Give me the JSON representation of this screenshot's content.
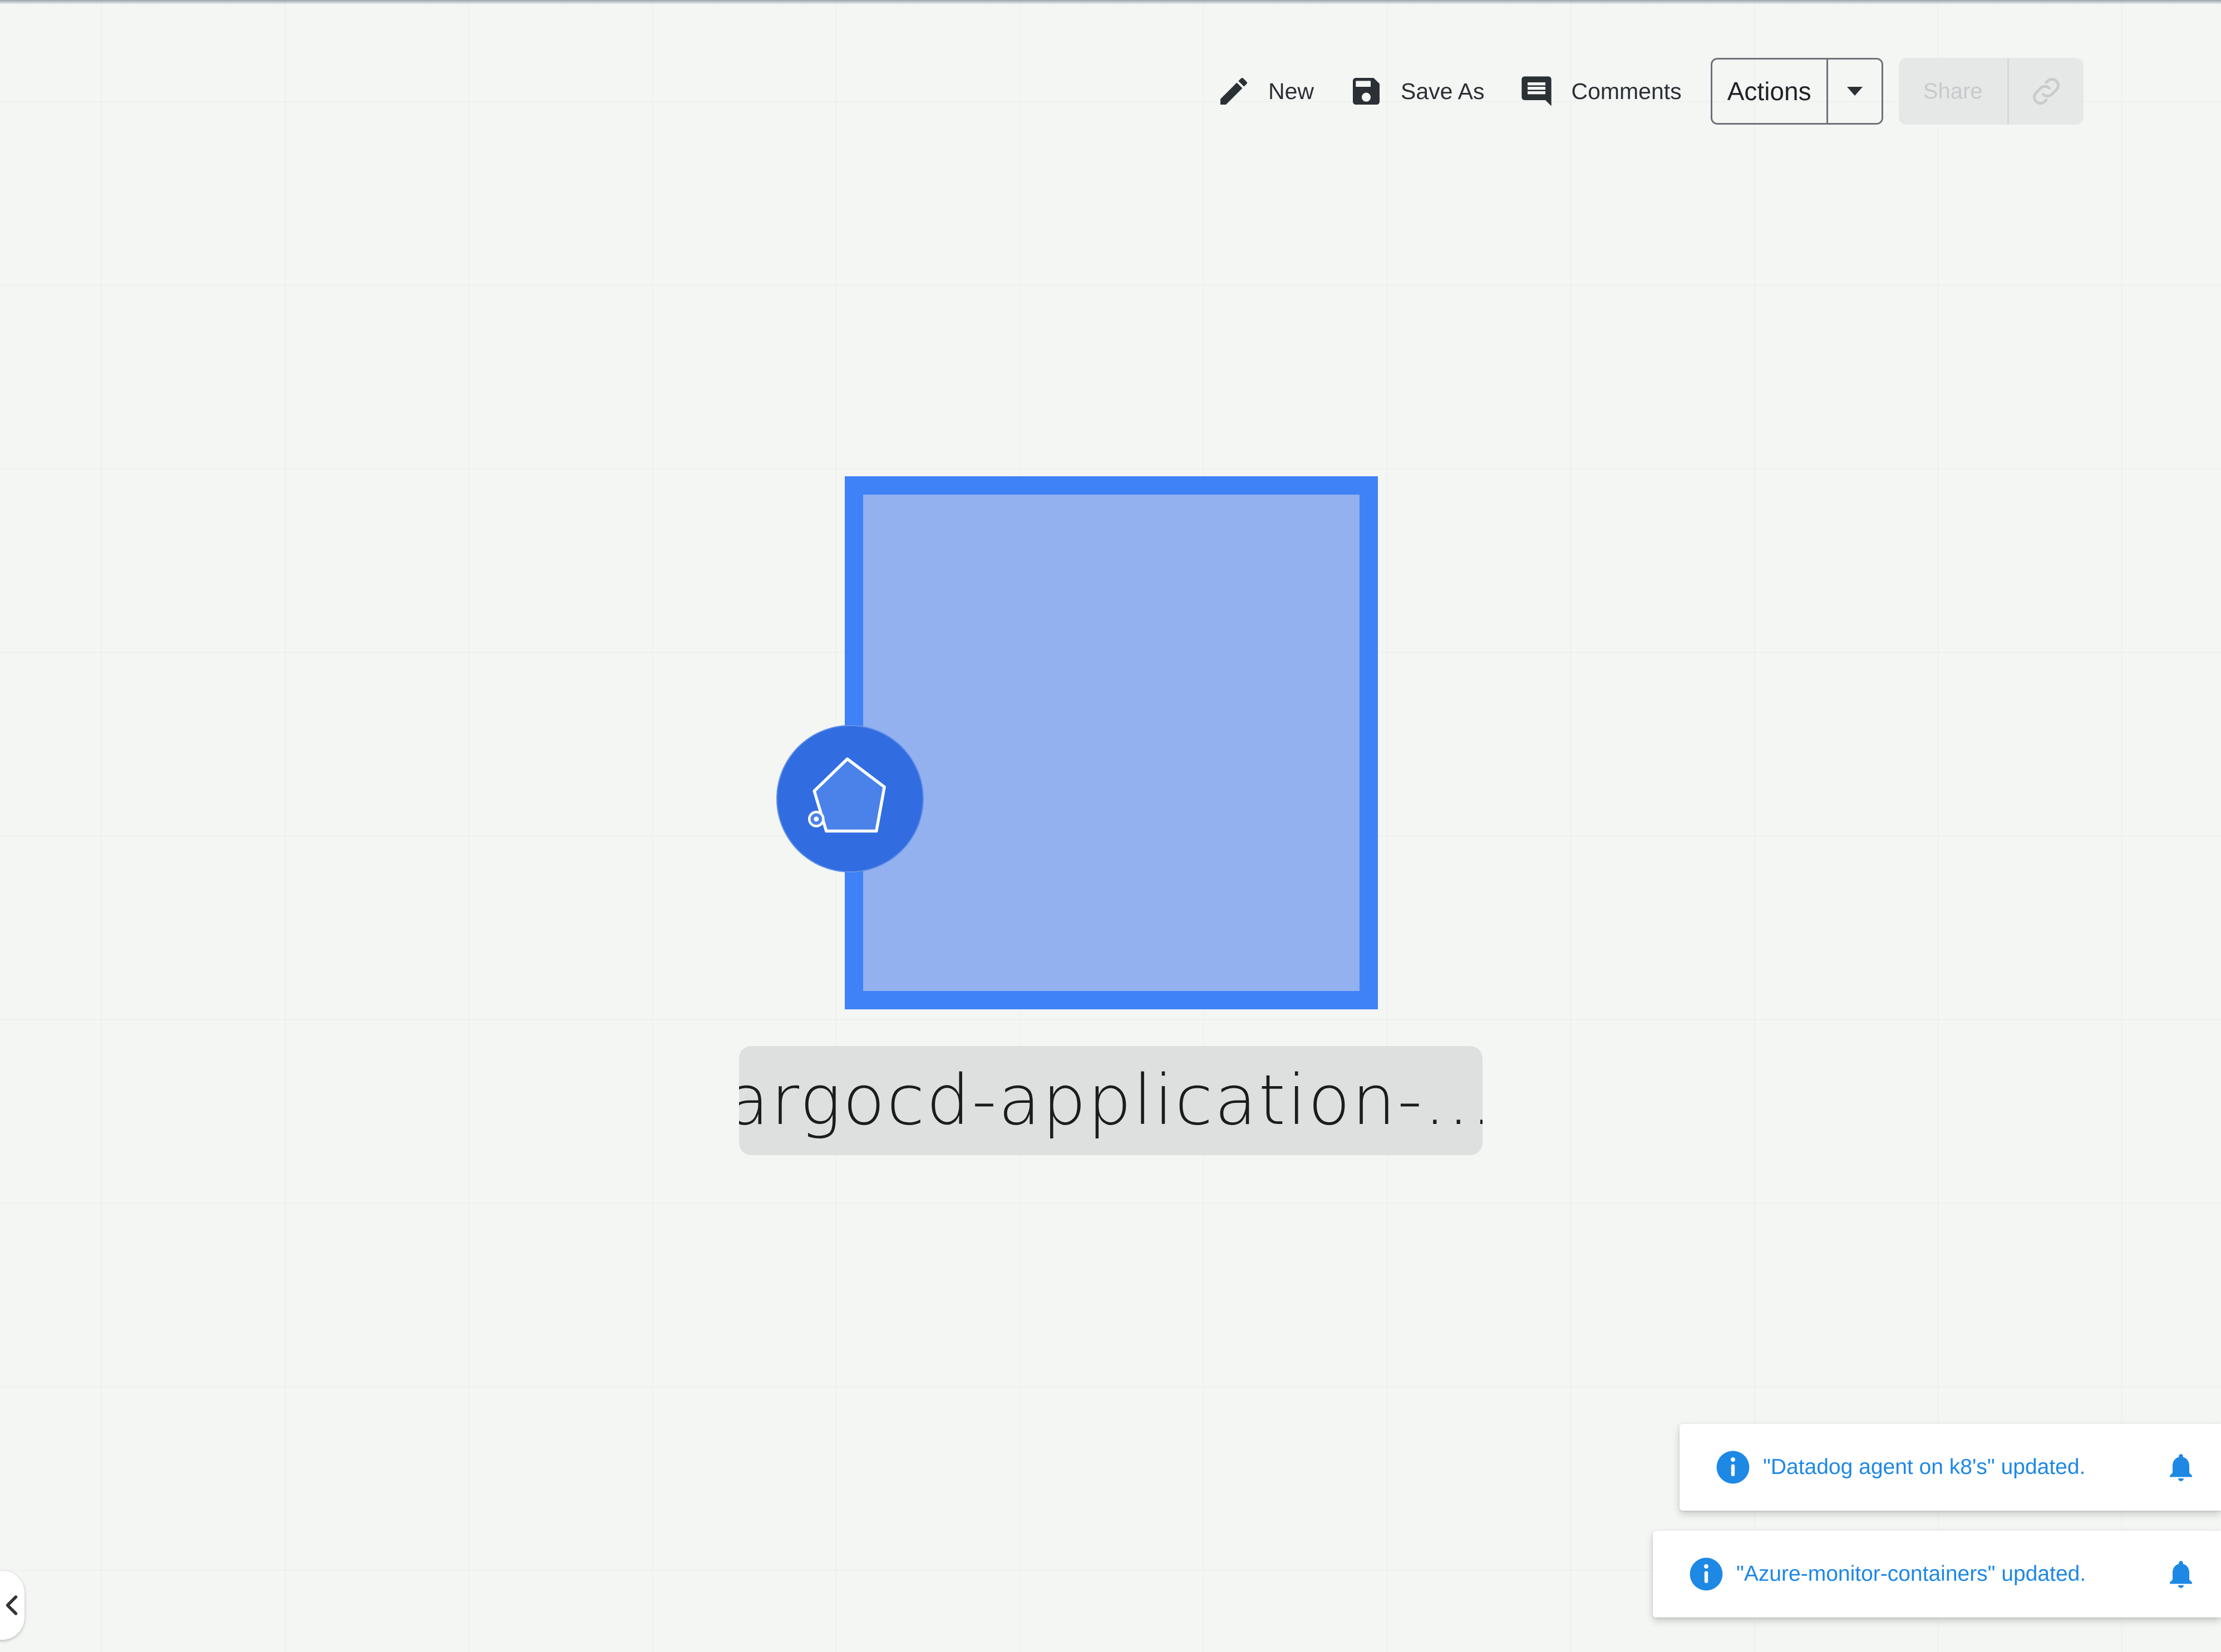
{
  "toolbar": {
    "new_label": "New",
    "save_as_label": "Save As",
    "comments_label": "Comments",
    "actions_label": "Actions",
    "share_label": "Share",
    "icons": {
      "new": "pencil-icon",
      "save_as": "floppy-disk-icon",
      "comments": "comment-icon",
      "actions_dropdown": "caret-down-icon",
      "copy_link": "link-icon"
    }
  },
  "canvas": {
    "node": {
      "label": "argocd-application-...",
      "badge_icon": "pentagon-icon",
      "border_color": "#3f82f7",
      "fill_color": "#93b1ef",
      "badge_color": "#316de0"
    }
  },
  "notifications": [
    {
      "message": "\"Datadog agent on k8's\" updated.",
      "icon": "info-icon",
      "action_icon": "bell-icon"
    },
    {
      "message": "\"Azure-monitor-containers\" updated.",
      "icon": "info-icon",
      "action_icon": "bell-icon"
    }
  ],
  "side_panel": {
    "toggle_icon": "chevron-left-icon"
  },
  "colors": {
    "accent": "#1e88e5",
    "canvas_background": "#f4f6f4"
  }
}
